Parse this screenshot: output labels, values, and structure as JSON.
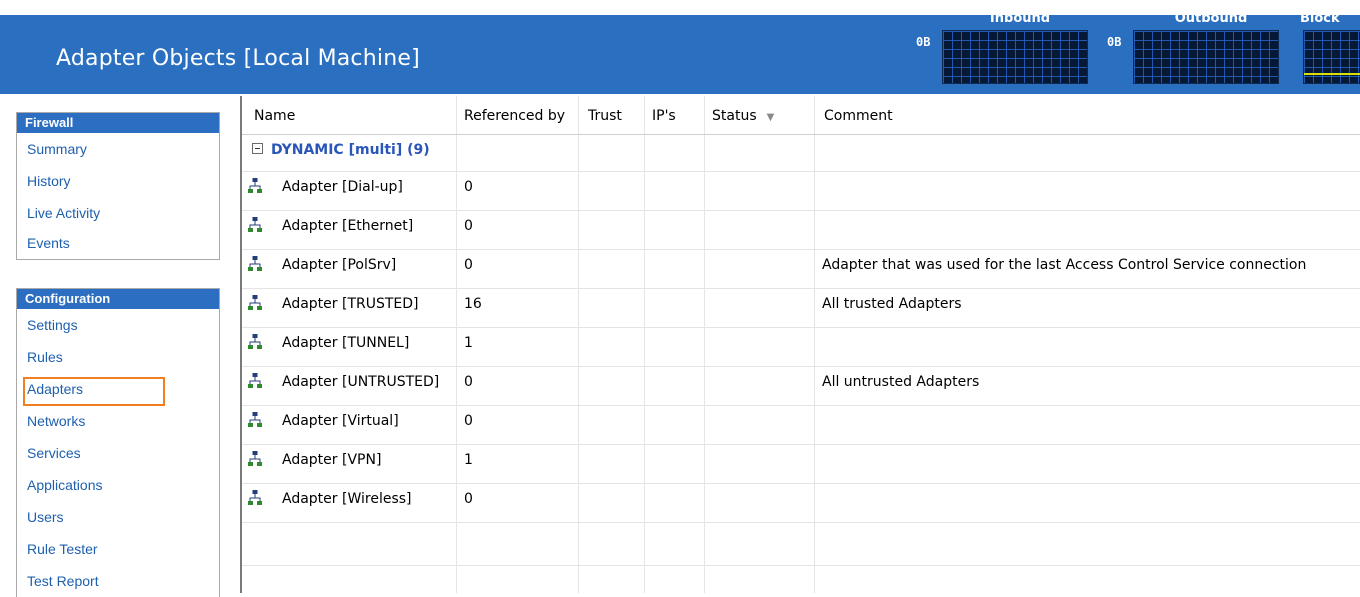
{
  "header": {
    "title": "Adapter Objects [Local Machine]",
    "meters": [
      {
        "label": "Inbound",
        "value": "0B"
      },
      {
        "label": "Outbound",
        "value": "0B"
      },
      {
        "label": "Block",
        "value": ""
      }
    ]
  },
  "sidebar": {
    "firewall": {
      "title": "Firewall",
      "items": [
        "Summary",
        "History",
        "Live Activity",
        "Events"
      ]
    },
    "configuration": {
      "title": "Configuration",
      "items": [
        "Settings",
        "Rules",
        "Adapters",
        "Networks",
        "Services",
        "Applications",
        "Users",
        "Rule Tester",
        "Test Report"
      ],
      "active": "Adapters"
    }
  },
  "table": {
    "columns": [
      "Name",
      "Referenced by",
      "Trust",
      "IP's",
      "Status",
      "Comment"
    ],
    "sort_icon": "▼",
    "group": {
      "label": "DYNAMIC [multi] (9)"
    },
    "rows": [
      {
        "name": "Adapter [Dial-up]",
        "referenced_by": "0",
        "trust": "",
        "ips": "",
        "status": "",
        "comment": ""
      },
      {
        "name": "Adapter [Ethernet]",
        "referenced_by": "0",
        "trust": "",
        "ips": "",
        "status": "",
        "comment": ""
      },
      {
        "name": "Adapter [PolSrv]",
        "referenced_by": "0",
        "trust": "",
        "ips": "",
        "status": "",
        "comment": "Adapter that was used for the last Access Control Service connection"
      },
      {
        "name": "Adapter [TRUSTED]",
        "referenced_by": "16",
        "trust": "",
        "ips": "",
        "status": "",
        "comment": "All trusted Adapters"
      },
      {
        "name": "Adapter [TUNNEL]",
        "referenced_by": "1",
        "trust": "",
        "ips": "",
        "status": "",
        "comment": ""
      },
      {
        "name": "Adapter [UNTRUSTED]",
        "referenced_by": "0",
        "trust": "",
        "ips": "",
        "status": "",
        "comment": "All untrusted Adapters"
      },
      {
        "name": "Adapter [Virtual]",
        "referenced_by": "0",
        "trust": "",
        "ips": "",
        "status": "",
        "comment": ""
      },
      {
        "name": "Adapter [VPN]",
        "referenced_by": "1",
        "trust": "",
        "ips": "",
        "status": "",
        "comment": ""
      },
      {
        "name": "Adapter [Wireless]",
        "referenced_by": "0",
        "trust": "",
        "ips": "",
        "status": "",
        "comment": ""
      }
    ]
  },
  "colors": {
    "header_bg": "#2a6fc0",
    "section_header_bg": "#2c6fc2",
    "nav_link": "#1e5fae",
    "group_text": "#2a56b8",
    "highlight": "#ef7f22",
    "meter_bg": "#051936"
  },
  "icons": {
    "adapter": "network-adapter-icon",
    "collapse": "collapse-minus-icon",
    "sort": "sort-descending-icon"
  }
}
